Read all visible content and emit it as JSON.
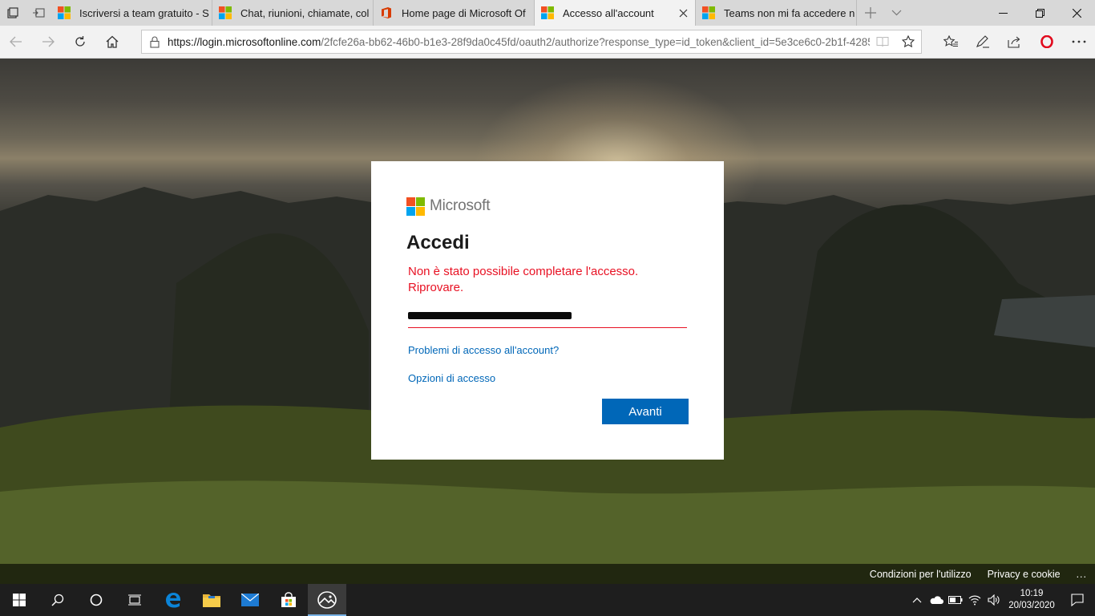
{
  "browser": {
    "tabs": [
      {
        "title": "Iscriversi a team gratuito - S",
        "favicon": "microsoft-logo",
        "active": false
      },
      {
        "title": "Chat, riunioni, chiamate, col",
        "favicon": "microsoft-logo",
        "active": false
      },
      {
        "title": "Home page di Microsoft Of",
        "favicon": "office-logo",
        "active": false
      },
      {
        "title": "Accesso all'account",
        "favicon": "microsoft-logo",
        "active": true
      },
      {
        "title": "Teams non mi fa accedere n",
        "favicon": "microsoft-logo",
        "active": false
      }
    ],
    "address": {
      "url_host": "https://login.microsoftonline.com",
      "url_path": "/2fcfe26a-bb62-46b0-b1e3-28f9da0c45fd/oauth2/authorize?response_type=id_token&client_id=5e3ce6c0-2b1f-4285"
    }
  },
  "login": {
    "brand": "Microsoft",
    "title": "Accedi",
    "error_line1": "Non è stato possibile completare l'accesso.",
    "error_line2": "Riprovare.",
    "link_problems": "Problemi di accesso all'account?",
    "link_options": "Opzioni di accesso",
    "next_button": "Avanti"
  },
  "footer": {
    "terms": "Condizioni per l'utilizzo",
    "privacy": "Privacy e cookie",
    "more": "..."
  },
  "taskbar": {
    "time": "10:19",
    "date": "20/03/2020"
  },
  "colors": {
    "ms_red": "#f25022",
    "ms_green": "#7fba00",
    "ms_blue": "#00a4ef",
    "ms_yellow": "#ffb900",
    "error": "#e81123",
    "link": "#0067b8",
    "button": "#0067b8"
  }
}
